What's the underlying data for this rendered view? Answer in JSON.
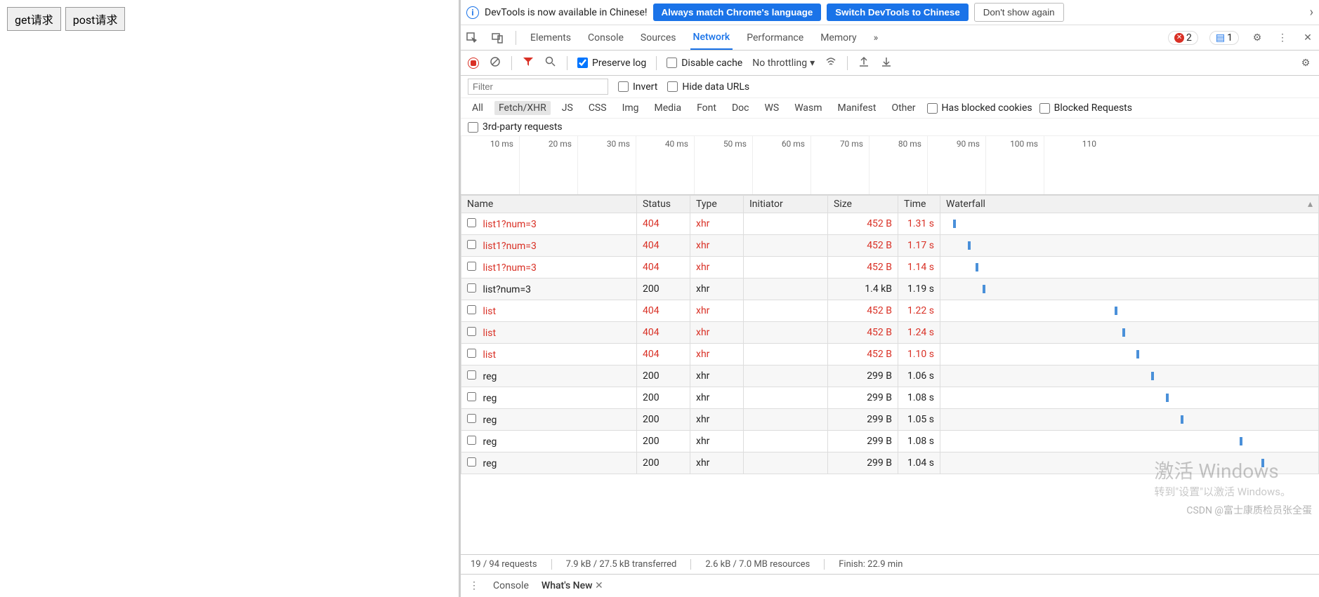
{
  "left": {
    "get_btn": "get请求",
    "post_btn": "post请求"
  },
  "infobar": {
    "message": "DevTools is now available in Chinese!",
    "btn_always": "Always match Chrome's language",
    "btn_switch": "Switch DevTools to Chinese",
    "btn_dont": "Don't show again"
  },
  "tabs": {
    "elements": "Elements",
    "console": "Console",
    "sources": "Sources",
    "network": "Network",
    "performance": "Performance",
    "memory": "Memory",
    "more": "»",
    "errors": "2",
    "issues": "1"
  },
  "toolbar": {
    "preserve_log": "Preserve log",
    "disable_cache": "Disable cache",
    "throttling": "No throttling"
  },
  "filterbar": {
    "filter_placeholder": "Filter",
    "invert": "Invert",
    "hide_urls": "Hide data URLs"
  },
  "typefilters": {
    "all": "All",
    "fetchxhr": "Fetch/XHR",
    "js": "JS",
    "css": "CSS",
    "img": "Img",
    "media": "Media",
    "font": "Font",
    "doc": "Doc",
    "ws": "WS",
    "wasm": "Wasm",
    "manifest": "Manifest",
    "other": "Other",
    "blocked_cookies": "Has blocked cookies",
    "blocked_requests": "Blocked Requests",
    "thirdparty": "3rd-party requests"
  },
  "timeline": [
    "10 ms",
    "20 ms",
    "30 ms",
    "40 ms",
    "50 ms",
    "60 ms",
    "70 ms",
    "80 ms",
    "90 ms",
    "100 ms",
    "110"
  ],
  "columns": {
    "name": "Name",
    "status": "Status",
    "type": "Type",
    "initiator": "Initiator",
    "size": "Size",
    "time": "Time",
    "waterfall": "Waterfall"
  },
  "rows": [
    {
      "name": "list1?num=3",
      "status": "404",
      "type": "xhr",
      "initiator": "",
      "size": "452 B",
      "time": "1.31 s",
      "err": true,
      "wf": 2
    },
    {
      "name": "list1?num=3",
      "status": "404",
      "type": "xhr",
      "initiator": "",
      "size": "452 B",
      "time": "1.17 s",
      "err": true,
      "wf": 6
    },
    {
      "name": "list1?num=3",
      "status": "404",
      "type": "xhr",
      "initiator": "",
      "size": "452 B",
      "time": "1.14 s",
      "err": true,
      "wf": 8
    },
    {
      "name": "list?num=3",
      "status": "200",
      "type": "xhr",
      "initiator": "",
      "size": "1.4 kB",
      "time": "1.19 s",
      "err": false,
      "wf": 10
    },
    {
      "name": "list",
      "status": "404",
      "type": "xhr",
      "initiator": "",
      "size": "452 B",
      "time": "1.22 s",
      "err": true,
      "wf": 46
    },
    {
      "name": "list",
      "status": "404",
      "type": "xhr",
      "initiator": "",
      "size": "452 B",
      "time": "1.24 s",
      "err": true,
      "wf": 48
    },
    {
      "name": "list",
      "status": "404",
      "type": "xhr",
      "initiator": "",
      "size": "452 B",
      "time": "1.10 s",
      "err": true,
      "wf": 52
    },
    {
      "name": "reg",
      "status": "200",
      "type": "xhr",
      "initiator": "",
      "size": "299 B",
      "time": "1.06 s",
      "err": false,
      "wf": 56
    },
    {
      "name": "reg",
      "status": "200",
      "type": "xhr",
      "initiator": "",
      "size": "299 B",
      "time": "1.08 s",
      "err": false,
      "wf": 60
    },
    {
      "name": "reg",
      "status": "200",
      "type": "xhr",
      "initiator": "",
      "size": "299 B",
      "time": "1.05 s",
      "err": false,
      "wf": 64
    },
    {
      "name": "reg",
      "status": "200",
      "type": "xhr",
      "initiator": "",
      "size": "299 B",
      "time": "1.08 s",
      "err": false,
      "wf": 80
    },
    {
      "name": "reg",
      "status": "200",
      "type": "xhr",
      "initiator": "",
      "size": "299 B",
      "time": "1.04 s",
      "err": false,
      "wf": 86
    }
  ],
  "status": {
    "requests": "19 / 94 requests",
    "transferred": "7.9 kB / 27.5 kB transferred",
    "resources": "2.6 kB / 7.0 MB resources",
    "finish": "Finish: 22.9 min"
  },
  "drawer": {
    "console": "Console",
    "whatsnew": "What's New"
  },
  "watermark": {
    "main": "激活 Windows",
    "sub": "转到\"设置\"以激活 Windows。"
  },
  "csdn": "CSDN @富士康质检员张全蛋"
}
